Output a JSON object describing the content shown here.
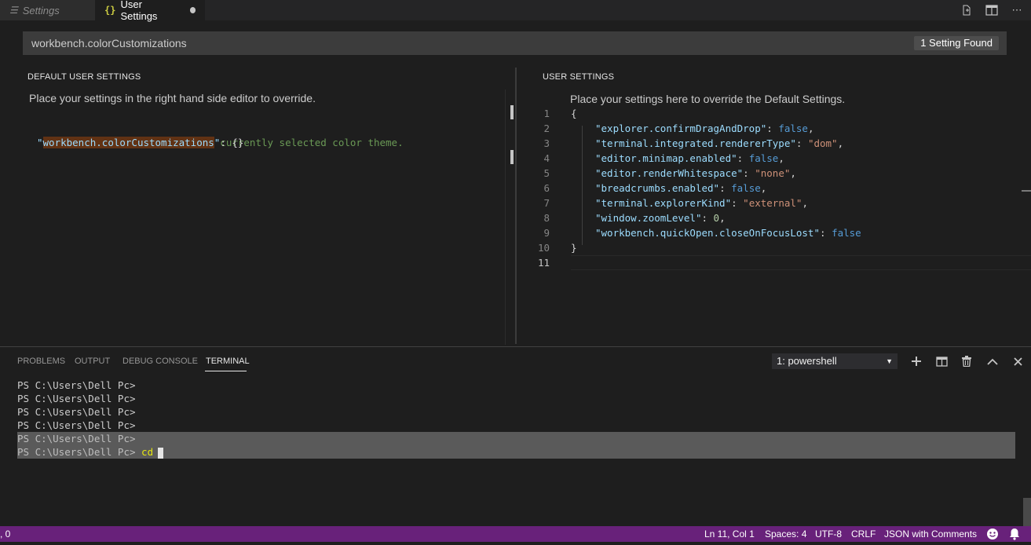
{
  "tabs": {
    "settings_label": "Settings",
    "user_settings_label": "User Settings"
  },
  "search": {
    "value": "workbench.colorCustomizations",
    "found_label": "1 Setting Found"
  },
  "default_pane": {
    "title": "DEFAULT USER SETTINGS",
    "hint": "Place your settings in the right hand side editor to override.",
    "comment": "// Overrides colors from the currently selected color theme.",
    "key": "workbench.colorCustomizations",
    "value": "{}"
  },
  "user_pane": {
    "title": "USER SETTINGS",
    "hint": "Place your settings here to override the Default Settings.",
    "line_numbers": [
      "1",
      "2",
      "3",
      "4",
      "5",
      "6",
      "7",
      "8",
      "9",
      "10",
      "11"
    ],
    "open_brace": "{",
    "close_brace": "}",
    "entries": [
      {
        "key": "explorer.confirmDragAndDrop",
        "value": "false",
        "kind": "bool"
      },
      {
        "key": "terminal.integrated.rendererType",
        "value": "\"dom\"",
        "kind": "str"
      },
      {
        "key": "editor.minimap.enabled",
        "value": "false",
        "kind": "bool"
      },
      {
        "key": "editor.renderWhitespace",
        "value": "\"none\"",
        "kind": "str"
      },
      {
        "key": "breadcrumbs.enabled",
        "value": "false",
        "kind": "bool"
      },
      {
        "key": "terminal.explorerKind",
        "value": "\"external\"",
        "kind": "str"
      },
      {
        "key": "window.zoomLevel",
        "value": "0",
        "kind": "num"
      },
      {
        "key": "workbench.quickOpen.closeOnFocusLost",
        "value": "false",
        "kind": "bool"
      }
    ]
  },
  "panel": {
    "tabs": [
      "PROBLEMS",
      "OUTPUT",
      "DEBUG CONSOLE",
      "TERMINAL"
    ],
    "terminal_select": "1: powershell",
    "prompt": "PS C:\\Users\\Dell Pc>",
    "typed": "cd"
  },
  "statusbar": {
    "left": ", 0",
    "position": "Ln 11, Col 1",
    "spaces": "Spaces: 4",
    "encoding": "UTF-8",
    "eol": "CRLF",
    "language": "JSON with Comments"
  },
  "colors": {
    "statusbar": "#68217a",
    "editor_bg": "#1e1e1e",
    "tab_bar": "#252526"
  }
}
